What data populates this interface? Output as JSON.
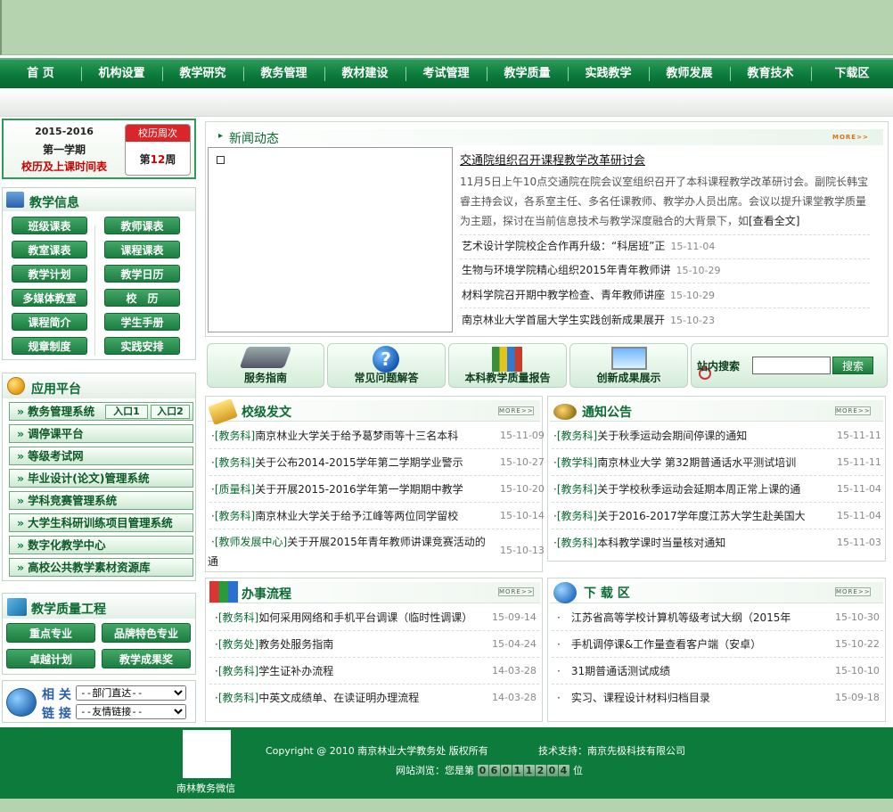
{
  "nav": [
    "首 页",
    "机构设置",
    "教学研究",
    "教务管理",
    "教材建设",
    "考试管理",
    "教学质量",
    "实践教学",
    "教师发展",
    "教育技术",
    "下载区"
  ],
  "calendar": {
    "years": "2015-2016",
    "semester": "第一学期",
    "title": "校历及上课时间表",
    "tag": "校历周次",
    "week_prefix": "第",
    "week_num": "12",
    "week_suffix": "周"
  },
  "teaching_info": {
    "title": "教学信息",
    "buttons": [
      "班级课表",
      "教师课表",
      "教室课表",
      "课程课表",
      "教学计划",
      "教学日历",
      "多媒体教室",
      "校　历",
      "课程简介",
      "学生手册",
      "规章制度",
      "实践安排"
    ]
  },
  "platform": {
    "title": "应用平台",
    "main": "教务管理系统",
    "entry1": "入口1",
    "entry2": "入口2",
    "items": [
      "调停课平台",
      "等级考试网",
      "毕业设计(论文)管理系统",
      "学科竞赛管理系统",
      "大学生科研训练项目管理系统",
      "数字化教学中心",
      "高校公共教学素材资源库"
    ]
  },
  "quality": {
    "title": "教学质量工程",
    "buttons": [
      "重点专业",
      "品牌特色专业",
      "卓越计划",
      "教学成果奖"
    ]
  },
  "links": {
    "label1": "相 关",
    "label2": "链 接",
    "select1": "--部门直达--",
    "select2": "--友情链接--"
  },
  "news": {
    "title": "新闻动态",
    "more": "MORE>>",
    "headline": "交通院组织召开课程教学改革研讨会",
    "summary": "11月5日上午10点交通院在院会议室组织召开了本科课程教学改革研讨会。副院长韩宝睿主持会议，各系室主任、多名任课教师、教学办人员出席。会议以提升课堂教学质量为主题，探讨在当前信息技术与教学深度融合的大背景下，如",
    "readmore": "[查看全文]",
    "items": [
      {
        "t": "艺术设计学院校企合作再升级：“科居班”正",
        "d": "15-11-04"
      },
      {
        "t": "生物与环境学院精心组织2015年青年教师讲",
        "d": "15-10-29"
      },
      {
        "t": "材料学院召开期中教学检查、青年教师讲座",
        "d": "15-10-29"
      },
      {
        "t": "南京林业大学首届大学生实践创新成果展开",
        "d": "15-10-23"
      }
    ]
  },
  "icons": [
    "服务指南",
    "常见问题解答",
    "本科教学质量报告",
    "创新成果展示"
  ],
  "search": {
    "label": "站内搜索",
    "button": "搜索"
  },
  "docs": {
    "title": "校级发文",
    "more": "MORE>>",
    "items": [
      {
        "c": "[教务科]",
        "t": "南京林业大学关于给予葛梦雨等十三名本科",
        "d": "15-11-09"
      },
      {
        "c": "[教务科]",
        "t": "关于公布2014-2015学年第二学期学业警示",
        "d": "15-10-27"
      },
      {
        "c": "[质量科]",
        "t": "关于开展2015-2016学年第一学期期中教学",
        "d": "15-10-20"
      },
      {
        "c": "[教务科]",
        "t": "南京林业大学关于给予江峰等两位同学留校",
        "d": "15-10-14"
      },
      {
        "c": "[教师发展中心]",
        "t": "关于开展2015年青年教师讲课竞赛活动的",
        "t2": "通",
        "d": "15-10-13"
      }
    ]
  },
  "notice": {
    "title": "通知公告",
    "more": "MORE>>",
    "items": [
      {
        "c": "[教务科]",
        "t": "关于秋季运动会期间停课的通知",
        "d": "15-11-11"
      },
      {
        "c": "[教学科]",
        "t": "南京林业大学 第32期普通话水平测试培训",
        "d": "15-11-11"
      },
      {
        "c": "[教务科]",
        "t": "关于学校秋季运动会延期本周正常上课的通",
        "d": "15-11-04"
      },
      {
        "c": "[教务科]",
        "t": "关于2016-2017学年度江苏大学生赴美国大",
        "d": "15-11-04"
      },
      {
        "c": "[教务科]",
        "t": "本科教学课时当量核对通知",
        "d": "15-11-03"
      }
    ]
  },
  "process": {
    "title": "办事流程",
    "more": "MORE>>",
    "items": [
      {
        "c": "[教务科]",
        "t": "如何采用网络和手机平台调课（临时性调课）",
        "d": "15-09-14"
      },
      {
        "c": "[教务处]",
        "t": "教务处服务指南",
        "d": "15-04-24"
      },
      {
        "c": "[教务科]",
        "t": "学生证补办流程",
        "d": "14-03-28"
      },
      {
        "c": "[教务科]",
        "t": "中英文成绩单、在读证明办理流程",
        "d": "14-03-28"
      }
    ]
  },
  "download": {
    "title": "下 载 区",
    "more": "MORE>>",
    "items": [
      {
        "t": "江苏省高等学校计算机等级考试大纲（2015年",
        "d": "15-10-30"
      },
      {
        "t": "手机调停课&工作量查看客户端（安卓）",
        "d": "15-10-22"
      },
      {
        "t": "31期普通话测试成绩",
        "d": "15-10-10"
      },
      {
        "t": "实习、课程设计材料归档目录",
        "d": "15-09-18"
      }
    ]
  },
  "footer": {
    "copyright": "Copyright @ 2010 南京林业大学教务处 版权所有",
    "support": "技术支持：南京先极科技有限公司",
    "visits_prefix": "网站浏览：您是第",
    "digits": [
      "0",
      "6",
      "0",
      "1",
      "1",
      "2",
      "0",
      "4"
    ],
    "visits_suffix": "位",
    "qr_caption": "南林教务微信"
  },
  "colors": {
    "nav": "#0b7a3b",
    "banner": "#b6d3b0",
    "accent": "#0b6b32"
  }
}
